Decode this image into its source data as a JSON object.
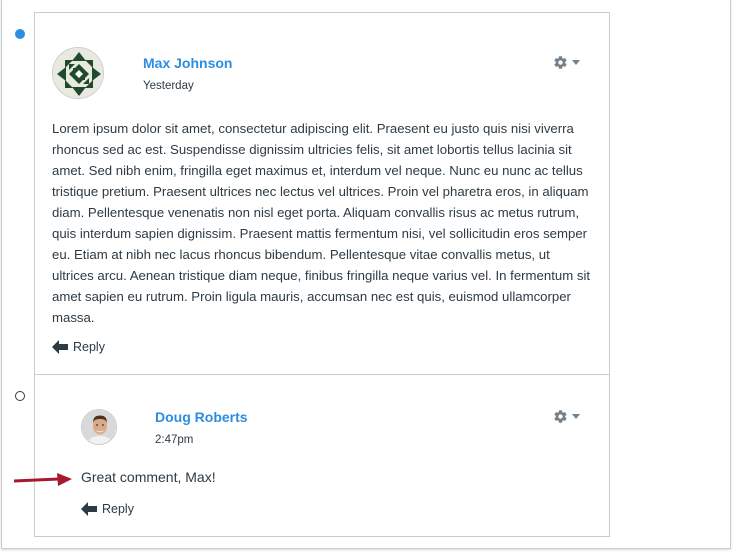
{
  "entries": [
    {
      "author": "Max Johnson",
      "timestamp": "Yesterday",
      "message": "Lorem ipsum dolor sit amet, consectetur adipiscing elit. Praesent eu justo quis nisi viverra rhoncus sed ac est. Suspendisse dignissim ultricies felis, sit amet lobortis tellus lacinia sit amet. Sed nibh enim, fringilla eget maximus et, interdum vel neque. Nunc eu nunc ac tellus tristique pretium. Praesent ultrices nec lectus vel ultrices. Proin vel pharetra eros, in aliquam diam. Pellentesque venenatis non nisl eget porta. Aliquam convallis risus ac metus rutrum, quis interdum sapien dignissim. Praesent mattis fermentum nisi, vel sollicitudin eros semper eu. Etiam at nibh nec lacus rhoncus bibendum. Pellentesque vitae convallis metus, ut ultrices arcu. Aenean tristique diam neque, finibus fringilla neque varius vel. In fermentum sit amet sapien eu rutrum. Proin ligula mauris, accumsan nec est quis, euismod ullamcorper massa.",
      "reply_label": "Reply",
      "unread": true
    },
    {
      "author": "Doug Roberts",
      "timestamp": "2:47pm",
      "message": "Great comment, Max!",
      "reply_label": "Reply",
      "unread": false
    }
  ],
  "icons": {
    "settings": "gear-icon",
    "settings_caret": "chevron-down-icon",
    "reply": "reply-arrow-icon",
    "pointer": "red-arrow-icon"
  },
  "colors": {
    "link": "#2d8ee0",
    "unread_dot": "#2d8ee0",
    "pointer_arrow": "#a6192e",
    "text": "#2d3b45",
    "border": "#c7cdd1"
  }
}
